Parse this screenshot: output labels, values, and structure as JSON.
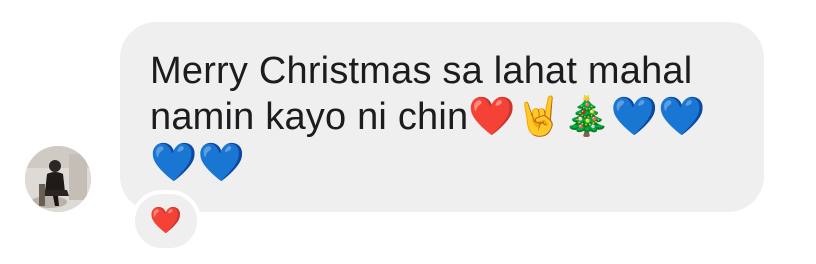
{
  "message": {
    "text": "Merry Christmas sa lahat mahal\nnamin kayo ni chin❤️🤘🎄💙💙\n💙💙"
  },
  "reaction": {
    "emoji": "❤️"
  },
  "avatar": {
    "icon": "user-avatar-photo"
  },
  "colors": {
    "bubble": "#efeff0",
    "text": "#1c1c1e",
    "background": "#ffffff"
  }
}
